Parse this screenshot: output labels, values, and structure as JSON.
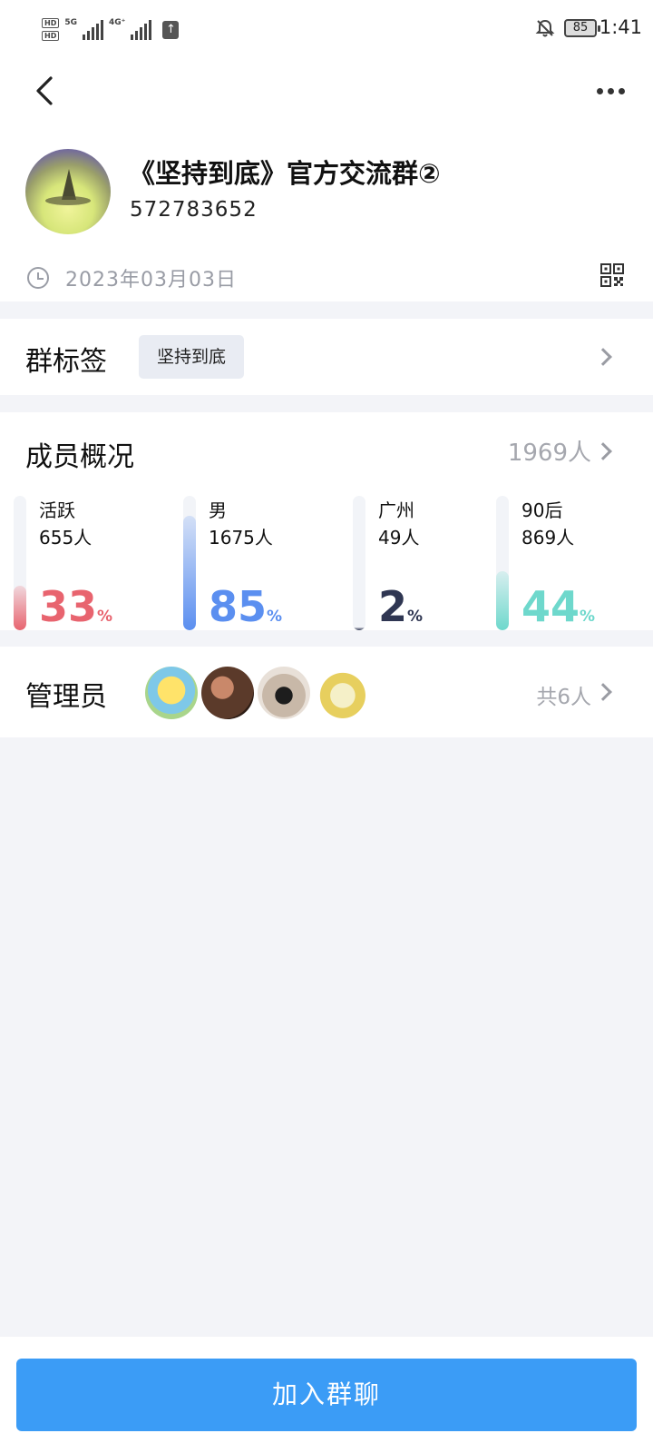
{
  "status_bar": {
    "hd1": "HD",
    "hd2": "HD",
    "net1": "5G",
    "net2": "4G⁺",
    "battery": "85",
    "time": "1:41"
  },
  "group": {
    "name": "《坚持到底》官方交流群②",
    "id": "572783652",
    "created_date": "2023年03月03日"
  },
  "tags": {
    "title": "群标签",
    "items": [
      "坚持到底"
    ]
  },
  "members": {
    "title": "成员概况",
    "count": "1969人",
    "stats": [
      {
        "label": "活跃",
        "count": "655人",
        "percent": 33,
        "percent_unit": "%",
        "color": "#e8646f",
        "track_fill": 0.33
      },
      {
        "label": "男",
        "count": "1675人",
        "percent": 85,
        "percent_unit": "%",
        "color": "#5b8ff0",
        "track_fill": 0.85
      },
      {
        "label": "广州",
        "count": "49人",
        "percent": 2,
        "percent_unit": "%",
        "color": "#2f3652",
        "track_fill": 0.02
      },
      {
        "label": "90后",
        "count": "869人",
        "percent": 44,
        "percent_unit": "%",
        "color": "#6ed8cc",
        "track_fill": 0.44
      }
    ]
  },
  "admins": {
    "title": "管理员",
    "total": "共6人"
  },
  "join_button": "加入群聊",
  "icons": [
    "back-arrow-icon",
    "more-icon",
    "clock-icon",
    "qr-code-icon",
    "chevron-right-icon"
  ]
}
